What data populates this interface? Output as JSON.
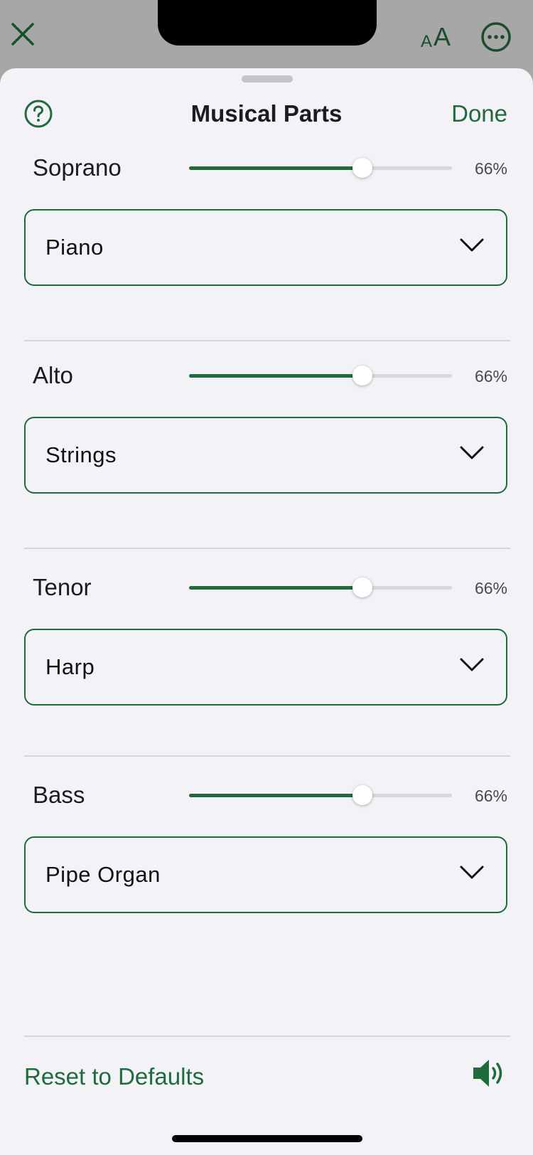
{
  "colors": {
    "accent": "#1f6b3d",
    "sheet_bg": "#f2f2f7",
    "dimmed_bg": "#a7a7a7"
  },
  "background_icons": [
    "close-icon",
    "text-size-icon",
    "more-icon"
  ],
  "header": {
    "help_icon": "help-circle-icon",
    "title": "Musical Parts",
    "done_label": "Done"
  },
  "parts": [
    {
      "name": "Soprano",
      "volume_percent": 66,
      "volume_label": "66%",
      "instrument": "Piano"
    },
    {
      "name": "Alto",
      "volume_percent": 66,
      "volume_label": "66%",
      "instrument": "Strings"
    },
    {
      "name": "Tenor",
      "volume_percent": 66,
      "volume_label": "66%",
      "instrument": "Harp"
    },
    {
      "name": "Bass",
      "volume_percent": 66,
      "volume_label": "66%",
      "instrument": "Pipe Organ"
    }
  ],
  "footer": {
    "reset_label": "Reset to Defaults",
    "speaker_icon": "speaker-icon"
  }
}
